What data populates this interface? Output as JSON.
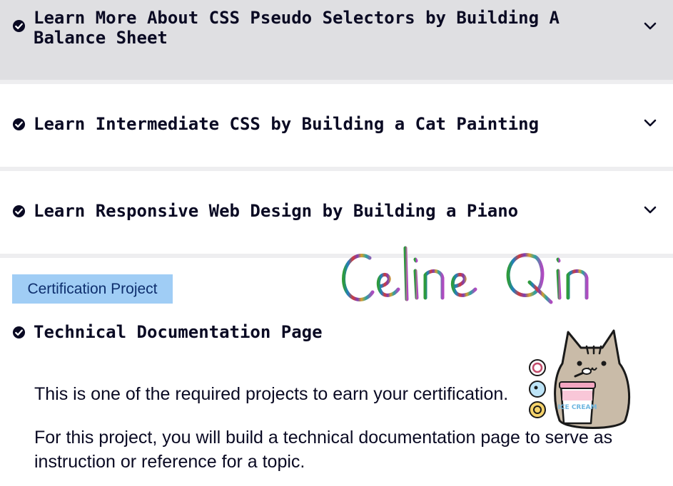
{
  "sections": [
    {
      "title": "Learn More About CSS Pseudo Selectors by Building A Balance Sheet"
    },
    {
      "title": "Learn Intermediate CSS by Building a Cat Painting"
    },
    {
      "title": "Learn Responsive Web Design by Building a Piano"
    }
  ],
  "project": {
    "badge": "Certification Project",
    "title": "Technical Documentation Page",
    "paragraphs": [
      "This is one of the required projects to earn your certification.",
      "For this project, you will build a technical documentation page to serve as instruction or reference for a topic."
    ]
  },
  "overlay": {
    "signature_text": "Celine Qin",
    "sticker_text": "ICE CREAM"
  },
  "colors": {
    "header_bg": "#dfdfe2",
    "badge_bg": "#a0cdf5",
    "text": "#0a0a23"
  }
}
